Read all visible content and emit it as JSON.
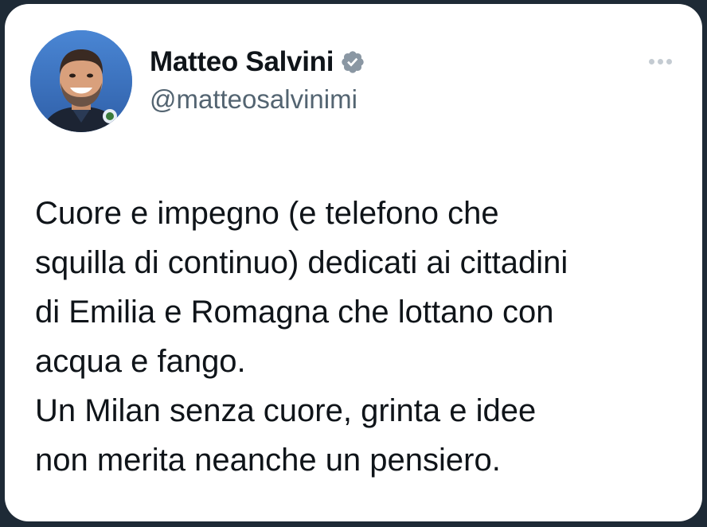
{
  "tweet": {
    "author": {
      "name": "Matteo Salvini",
      "handle": "@matteosalvinimi",
      "verified": true,
      "avatar_icon": "profile-photo"
    },
    "more_icon": "more-horizontal-icon",
    "text_lines": [
      "Cuore e impegno (e telefono che",
      "squilla di continuo) dedicati ai cittadini",
      "di Emilia e Romagna che lottano con",
      "acqua e fango.",
      "Un Milan senza cuore, grinta e idee",
      "non merita neanche un pensiero."
    ]
  },
  "colors": {
    "background": "#1e2a36",
    "card": "#ffffff",
    "text": "#0f1419",
    "secondary_text": "#536471",
    "verified_badge": "#8a97a3"
  }
}
